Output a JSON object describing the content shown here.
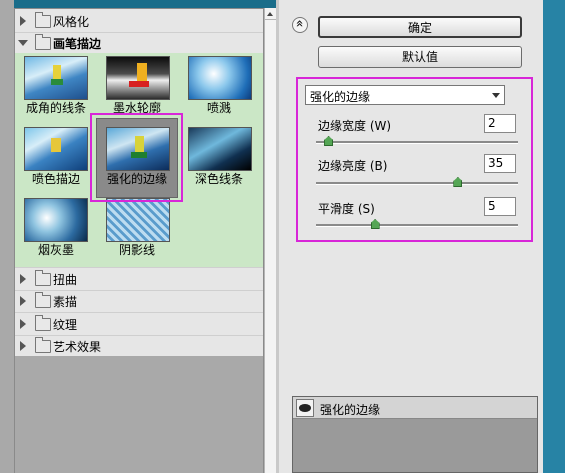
{
  "gallery": {
    "categories_top": [
      {
        "label": "风格化"
      },
      {
        "label": "画笔描边"
      }
    ],
    "brush_strokes_filters": [
      {
        "label": "成角的线条"
      },
      {
        "label": "墨水轮廓"
      },
      {
        "label": "喷溅"
      },
      {
        "label": "喷色描边"
      },
      {
        "label": "强化的边缘"
      },
      {
        "label": "深色线条"
      },
      {
        "label": "烟灰墨"
      },
      {
        "label": "阴影线"
      }
    ],
    "categories_bottom": [
      {
        "label": "扭曲"
      },
      {
        "label": "素描"
      },
      {
        "label": "纹理"
      },
      {
        "label": "艺术效果"
      }
    ]
  },
  "buttons": {
    "ok_label": "确定",
    "default_label": "默认值"
  },
  "settings": {
    "filter_select_value": "强化的边缘",
    "params": [
      {
        "label": "边缘宽度 (W)",
        "value": "2",
        "slider_fraction": 0.06
      },
      {
        "label": "边缘亮度 (B)",
        "value": "35",
        "slider_fraction": 0.7
      },
      {
        "label": "平滑度 (S)",
        "value": "5",
        "slider_fraction": 0.29
      }
    ]
  },
  "layers": {
    "items": [
      {
        "label": "强化的边缘",
        "visible": true
      }
    ]
  },
  "colors": {
    "highlight": "#d826d8",
    "open_category_bg": "#cbe7c6"
  }
}
